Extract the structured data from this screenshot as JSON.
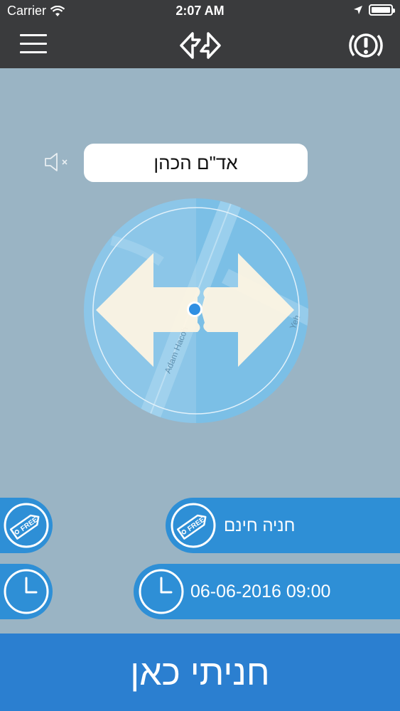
{
  "status_bar": {
    "carrier": "Carrier",
    "time": "2:07 AM"
  },
  "nav": {
    "menu_icon": "hamburger-menu-icon",
    "swap_icon": "swap-direction-icon",
    "alert_icon": "alert-circle-icon"
  },
  "street": {
    "name": "אד\"ם הכהן",
    "mute_icon": "speaker-muted-icon"
  },
  "compass": {
    "map_street_label": "Adam Hacoh",
    "map_fragment_label": "Yeh"
  },
  "parking": {
    "type_label": "חניה חינם",
    "type_icon": "free-tag-icon",
    "datetime": "06-06-2016 09:00",
    "datetime_icon": "clock-icon"
  },
  "action": {
    "parked_here_label": "חניתי כאן"
  },
  "colors": {
    "nav_bg": "#3a3b3d",
    "content_bg": "#9ab4c4",
    "pill_blue": "#2e8fd6",
    "bottom_blue": "#2b7fd0"
  }
}
